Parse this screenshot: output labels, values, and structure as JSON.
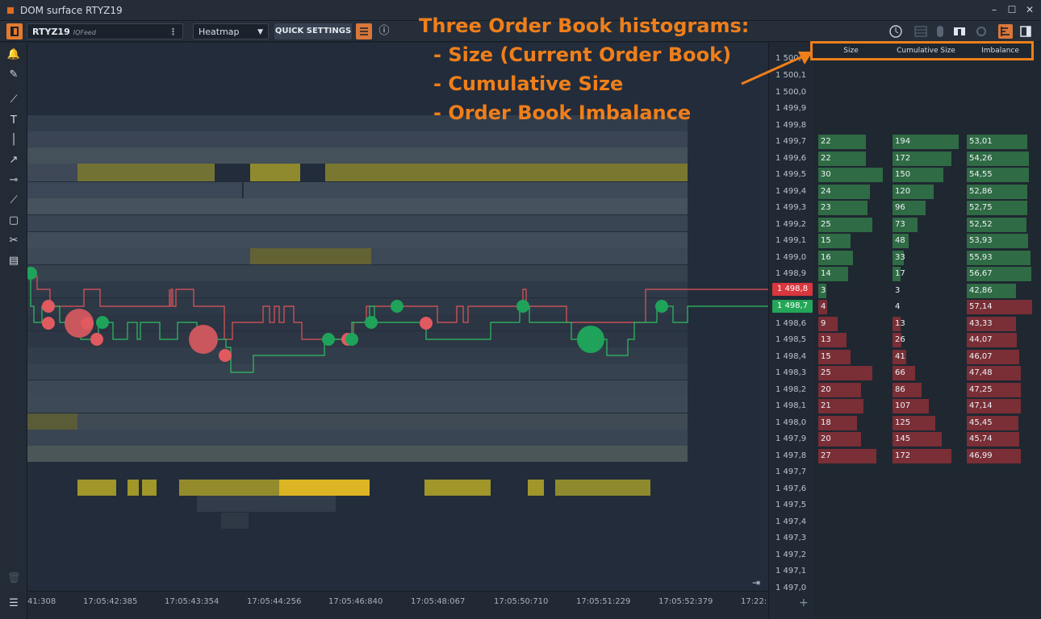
{
  "window": {
    "title": "DOM surface RTYZ19"
  },
  "toolbar": {
    "symbol": "RTYZ19",
    "feed": "IQFeed",
    "view_mode": "Heatmap",
    "quick_settings_label": "QUICK SETTINGS"
  },
  "annotation": {
    "lines": [
      "Three Order Book histograms:",
      " - Size (Current Order Book)",
      " - Cumulative Size",
      " - Order Book Imbalance"
    ]
  },
  "histogram_headers": [
    "Size",
    "Cumulative Size",
    "Imbalance"
  ],
  "price_levels": [
    "1 500,1",
    "1 500,0",
    "1 499,9",
    "1 499,8",
    "1 499,7",
    "1 499,6",
    "1 499,5",
    "1 499,4",
    "1 499,3",
    "1 499,2",
    "1 499,1",
    "1 499,0",
    "1 498,9",
    "1 498,8",
    "1 498,7",
    "1 498,6",
    "1 498,5",
    "1 498,4",
    "1 498,3",
    "1 498,2",
    "1 498,1",
    "1 498,0",
    "1 497,9",
    "1 497,8",
    "1 497,7",
    "1 497,6",
    "1 497,5",
    "1 497,4",
    "1 497,3",
    "1 497,2",
    "1 497,1",
    "1 497,0"
  ],
  "price_top_partial": "1 500,",
  "ask_price": "1 498,8",
  "bid_price": "1 498,7",
  "book": [
    {
      "price": "1 499,7",
      "side": "bid",
      "size": "22",
      "cum": "194",
      "imb": "53,01"
    },
    {
      "price": "1 499,6",
      "side": "bid",
      "size": "22",
      "cum": "172",
      "imb": "54,26"
    },
    {
      "price": "1 499,5",
      "side": "bid",
      "size": "30",
      "cum": "150",
      "imb": "54,55"
    },
    {
      "price": "1 499,4",
      "side": "bid",
      "size": "24",
      "cum": "120",
      "imb": "52,86"
    },
    {
      "price": "1 499,3",
      "side": "bid",
      "size": "23",
      "cum": "96",
      "imb": "52,75"
    },
    {
      "price": "1 499,2",
      "side": "bid",
      "size": "25",
      "cum": "73",
      "imb": "52,52"
    },
    {
      "price": "1 499,1",
      "side": "bid",
      "size": "15",
      "cum": "48",
      "imb": "53,93"
    },
    {
      "price": "1 499,0",
      "side": "bid",
      "size": "16",
      "cum": "33",
      "imb": "55,93"
    },
    {
      "price": "1 498,9",
      "side": "bid",
      "size": "14",
      "cum": "17",
      "imb": "56,67"
    },
    {
      "price": "1 498,8",
      "side": "bid",
      "size": "3",
      "cum": "3",
      "imb": "42,86"
    },
    {
      "price": "1 498,7",
      "side": "ask",
      "size": "4",
      "cum": "4",
      "imb": "57,14"
    },
    {
      "price": "1 498,6",
      "side": "ask",
      "size": "9",
      "cum": "13",
      "imb": "43,33"
    },
    {
      "price": "1 498,5",
      "side": "ask",
      "size": "13",
      "cum": "26",
      "imb": "44,07"
    },
    {
      "price": "1 498,4",
      "side": "ask",
      "size": "15",
      "cum": "41",
      "imb": "46,07"
    },
    {
      "price": "1 498,3",
      "side": "ask",
      "size": "25",
      "cum": "66",
      "imb": "47,48"
    },
    {
      "price": "1 498,2",
      "side": "ask",
      "size": "20",
      "cum": "86",
      "imb": "47,25"
    },
    {
      "price": "1 498,1",
      "side": "ask",
      "size": "21",
      "cum": "107",
      "imb": "47,14"
    },
    {
      "price": "1 498,0",
      "side": "ask",
      "size": "18",
      "cum": "125",
      "imb": "45,45"
    },
    {
      "price": "1 497,9",
      "side": "ask",
      "size": "20",
      "cum": "145",
      "imb": "45,74"
    },
    {
      "price": "1 497,8",
      "side": "ask",
      "size": "27",
      "cum": "172",
      "imb": "46,99"
    }
  ],
  "time_labels": [
    "41:308",
    "17:05:42:385",
    "17:05:43:354",
    "17:05:44:256",
    "17:05:46:840",
    "17:05:48:067",
    "17:05:50:710",
    "17:05:51:229",
    "17:05:52:379",
    "17:22:"
  ],
  "colors": {
    "accent": "#ef7f1a",
    "bid_bar": "#2f6b44",
    "ask_bar": "#7a2e36",
    "ask_tag": "#d9363e",
    "bid_tag": "#23a657",
    "trade_buy": "#1fa35a",
    "trade_sell": "#e05a60"
  }
}
